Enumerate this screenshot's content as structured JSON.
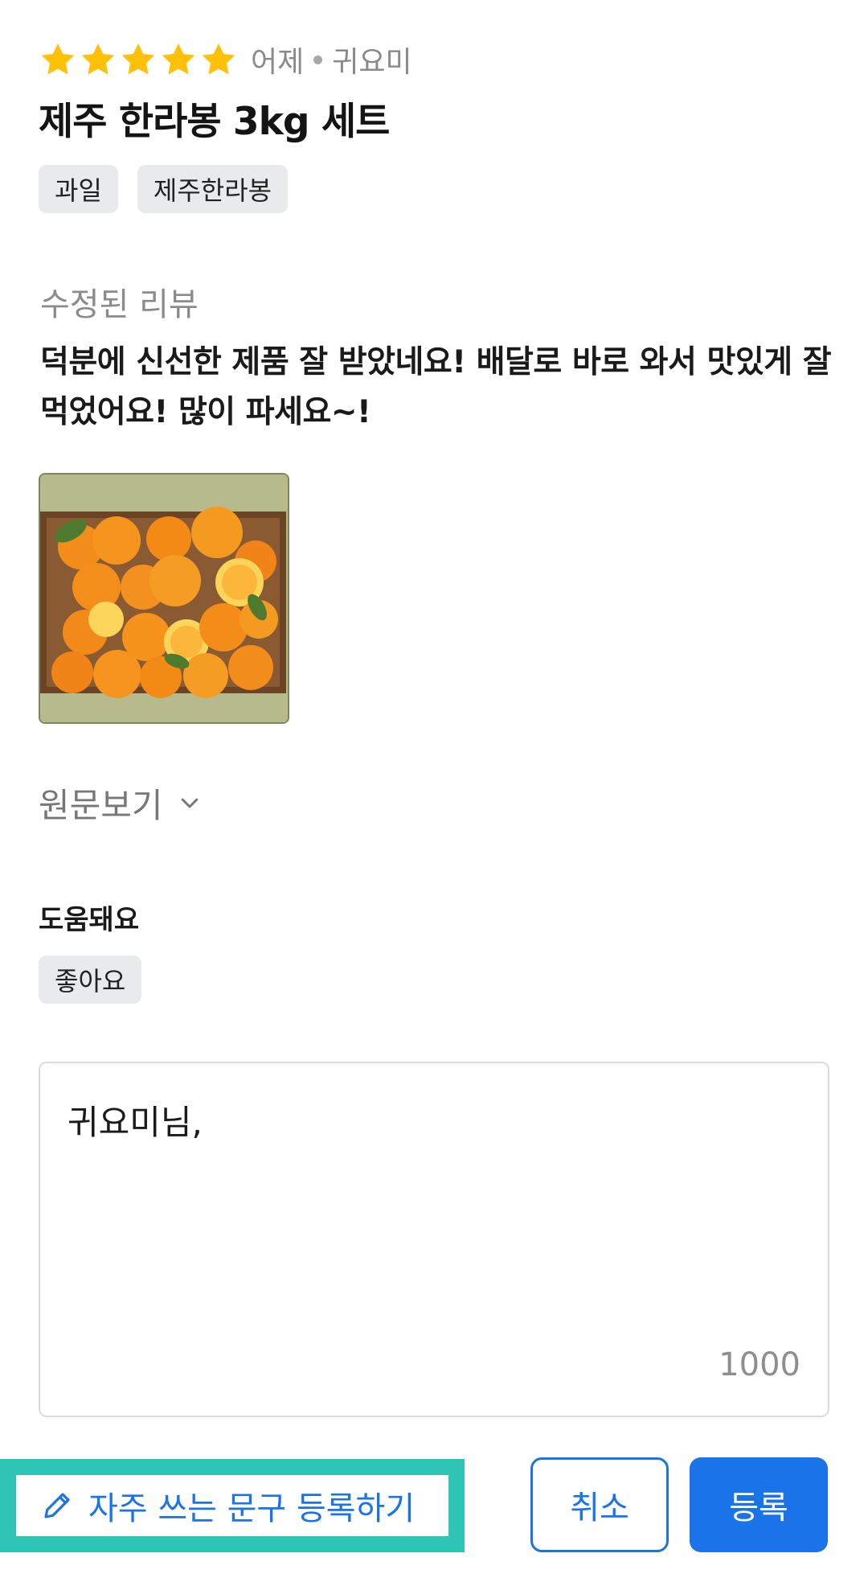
{
  "review": {
    "rating": 5,
    "rating_max": 5,
    "date": "어제",
    "author": "귀요미",
    "product_title": "제주 한라봉 3kg 세트",
    "tags": [
      "과일",
      "제주한라봉"
    ],
    "section_label": "수정된 리뷰",
    "text": "덕분에 신선한 제품 잘 받았네요! 배달로 바로 와서 맛있게 잘 먹었어요! 많이 파세요~!",
    "photo_icon": "orange-box-photo",
    "view_original_label": "원문보기",
    "helpful_label": "도움돼요",
    "helpful_chip": "좋아요"
  },
  "reply": {
    "value": "귀요미님,",
    "char_limit": "1000"
  },
  "actions": {
    "phrase_label": "자주 쓰는 문구 등록하기",
    "cancel_label": "취소",
    "submit_label": "등록"
  },
  "colors": {
    "star": "#ffc107",
    "accent": "#1a73e8",
    "highlight": "#2ec4b6"
  }
}
